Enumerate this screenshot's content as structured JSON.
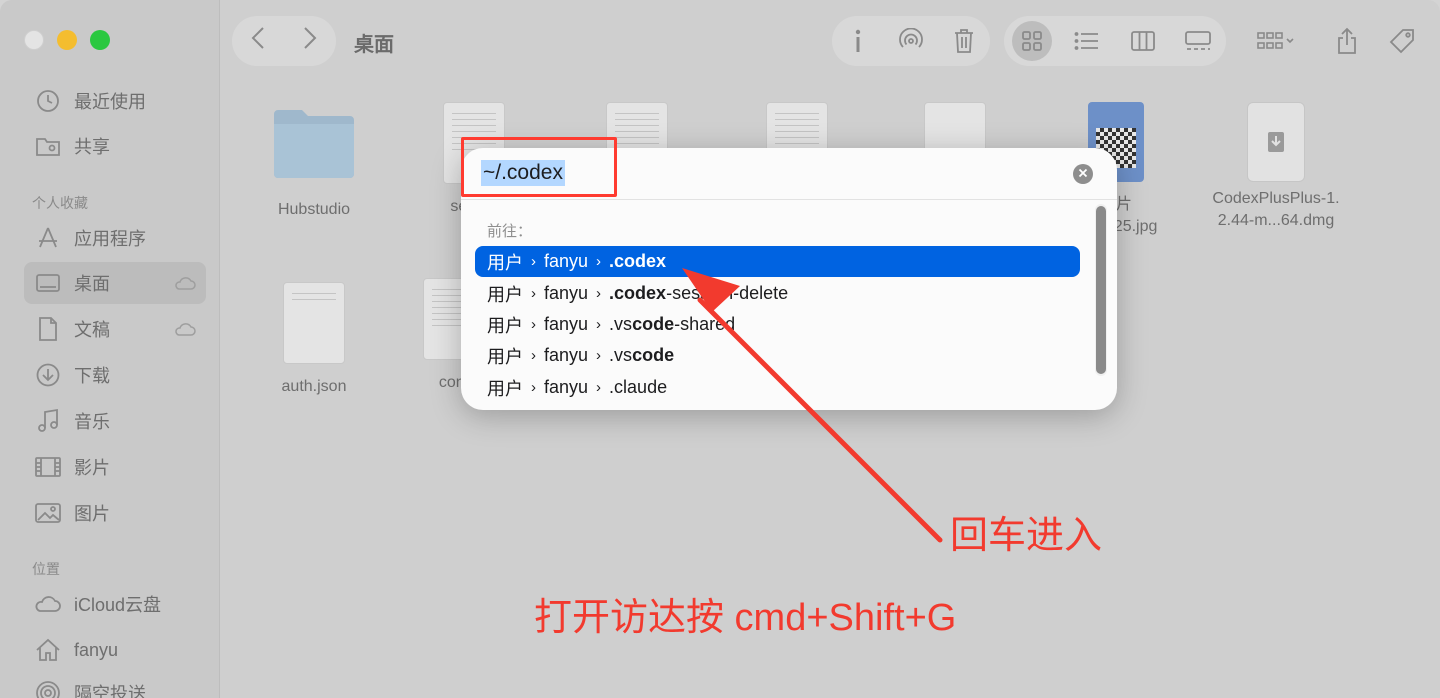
{
  "window": {
    "title": "桌面"
  },
  "sidebar": {
    "sections": {
      "favorites": "个人收藏",
      "locations": "位置"
    },
    "items": [
      {
        "label": "最近使用",
        "icon": "clock-icon"
      },
      {
        "label": "共享",
        "icon": "shared-folder-icon"
      },
      {
        "label": "应用程序",
        "icon": "applications-icon"
      },
      {
        "label": "桌面",
        "icon": "desktop-icon",
        "active": true
      },
      {
        "label": "文稿",
        "icon": "document-icon"
      },
      {
        "label": "下载",
        "icon": "download-icon"
      },
      {
        "label": "音乐",
        "icon": "music-icon"
      },
      {
        "label": "影片",
        "icon": "film-icon"
      },
      {
        "label": "图片",
        "icon": "photo-icon"
      },
      {
        "label": "iCloud云盘",
        "icon": "cloud-icon"
      },
      {
        "label": "fanyu",
        "icon": "home-icon"
      },
      {
        "label": "隔空投送",
        "icon": "airdrop-icon"
      }
    ]
  },
  "files": [
    {
      "name": "Hubstudio",
      "type": "folder"
    },
    {
      "name": "setting",
      "type": "document"
    },
    {
      "name": "图片",
      "name2": "_425.jpg",
      "type": "image"
    },
    {
      "name": "CodexPlusPlus-1.",
      "name2": "2.44-m...64.dmg",
      "type": "dmg"
    },
    {
      "name": "auth.json",
      "type": "document"
    },
    {
      "name": "conf",
      "type": "document"
    }
  ],
  "goto": {
    "input_value": "~/.codex",
    "goto_label": "前往：",
    "suggestions": [
      {
        "p1": "用户",
        "p2": "fanyu",
        "bold": ".codex",
        "rest": "",
        "selected": true
      },
      {
        "p1": "用户",
        "p2": "fanyu",
        "bold": ".codex",
        "rest": "-session-delete",
        "selected": false
      },
      {
        "p1": "用户",
        "p2": "fanyu",
        "pre": ".vs",
        "bold": "code",
        "rest": "-shared",
        "selected": false
      },
      {
        "p1": "用户",
        "p2": "fanyu",
        "pre": ".vs",
        "bold": "code",
        "rest": "",
        "selected": false
      },
      {
        "p1": "用户",
        "p2": "fanyu",
        "pre": ".claude",
        "bold": "",
        "rest": "",
        "selected": false
      }
    ]
  },
  "annotations": {
    "enter_hint": "回车进入",
    "shortcut_hint": "打开访达按 cmd+Shift+G",
    "color": "#f23a2e"
  }
}
